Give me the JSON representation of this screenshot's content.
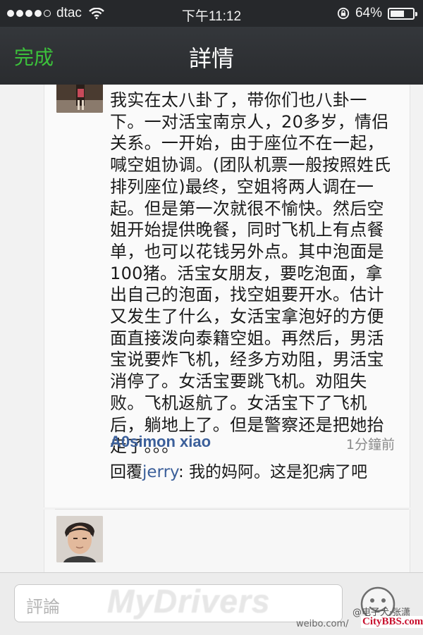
{
  "status_bar": {
    "carrier": "dtac",
    "time": "下午11:12",
    "battery": "64%",
    "battery_level": 0.64
  },
  "nav": {
    "done_label": "完成",
    "title": "詳情"
  },
  "comment": {
    "text": "我实在太八卦了，带你们也八卦一下。一对活宝南京人，20多岁，情侣关系。一开始，由于座位不在一起，喊空姐协调。(团队机票一般按照姓氏排列座位)最终，空姐将两人调在一起。但是第一次就很不愉快。然后空姐开始提供晚餐，同时飞机上有点餐单，也可以花钱另外点。其中泡面是100猪。活宝女朋友，要吃泡面，拿出自己的泡面，找空姐要开水。估计又发生了什么，女活宝拿泡好的方便面直接泼向泰籍空姐。再然后，男活宝说要炸飞机，经多方劝阻，男活宝消停了。女活宝要跳飞机。劝阻失败。飞机返航了。女活宝下了飞机后，躺地上了。但是警察还是把她抬走了。。。"
  },
  "reply": {
    "name": "A0simon xiao",
    "time": "1分鐘前",
    "prefix": "回覆",
    "mention": "jerry",
    "text": ": 我的妈阿。这是犯病了吧"
  },
  "input": {
    "placeholder": "評論"
  },
  "watermarks": {
    "mydrivers": "MyDrivers",
    "handle": "@电子犬·张潇",
    "weibo": "weibo.com/",
    "citybbs": "CityBBS.com"
  },
  "icons": {
    "wifi": "wifi-icon",
    "rotation_lock": "rotation-lock-icon",
    "battery": "battery-icon",
    "emoji": "smiley-face-icon"
  }
}
